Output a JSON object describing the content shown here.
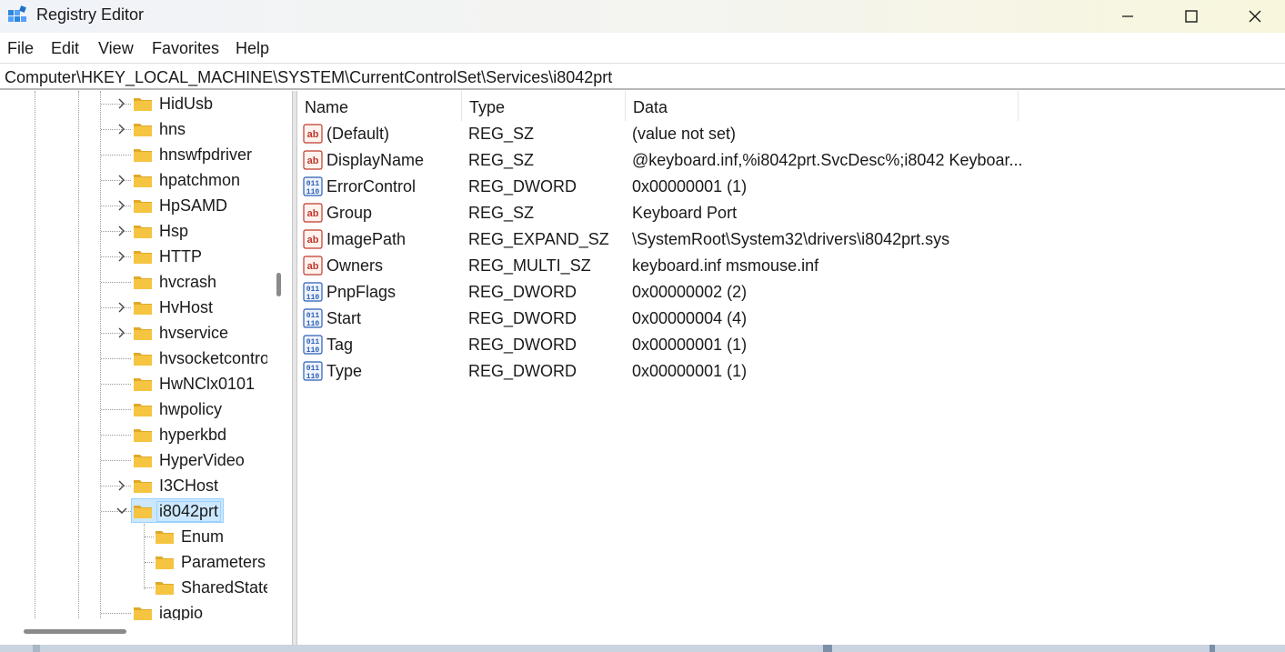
{
  "window": {
    "title": "Registry Editor",
    "icon": "registry-editor-icon"
  },
  "menu": {
    "items": [
      "File",
      "Edit",
      "View",
      "Favorites",
      "Help"
    ]
  },
  "address": {
    "path": "Computer\\HKEY_LOCAL_MACHINE\\SYSTEM\\CurrentControlSet\\Services\\i8042prt"
  },
  "tree": {
    "items": [
      {
        "label": "HidUsb",
        "expandable": true,
        "expanded": false,
        "level": 0
      },
      {
        "label": "hns",
        "expandable": true,
        "expanded": false,
        "level": 0
      },
      {
        "label": "hnswfpdriver",
        "expandable": false,
        "expanded": false,
        "level": 0
      },
      {
        "label": "hpatchmon",
        "expandable": true,
        "expanded": false,
        "level": 0
      },
      {
        "label": "HpSAMD",
        "expandable": true,
        "expanded": false,
        "level": 0
      },
      {
        "label": "Hsp",
        "expandable": true,
        "expanded": false,
        "level": 0
      },
      {
        "label": "HTTP",
        "expandable": true,
        "expanded": false,
        "level": 0
      },
      {
        "label": "hvcrash",
        "expandable": false,
        "expanded": false,
        "level": 0
      },
      {
        "label": "HvHost",
        "expandable": true,
        "expanded": false,
        "level": 0
      },
      {
        "label": "hvservice",
        "expandable": true,
        "expanded": false,
        "level": 0
      },
      {
        "label": "hvsocketcontrol",
        "expandable": false,
        "expanded": false,
        "level": 0
      },
      {
        "label": "HwNClx0101",
        "expandable": false,
        "expanded": false,
        "level": 0
      },
      {
        "label": "hwpolicy",
        "expandable": false,
        "expanded": false,
        "level": 0
      },
      {
        "label": "hyperkbd",
        "expandable": false,
        "expanded": false,
        "level": 0
      },
      {
        "label": "HyperVideo",
        "expandable": false,
        "expanded": false,
        "level": 0
      },
      {
        "label": "I3CHost",
        "expandable": true,
        "expanded": false,
        "level": 0
      },
      {
        "label": "i8042prt",
        "expandable": true,
        "expanded": true,
        "level": 0,
        "selected": true
      },
      {
        "label": "Enum",
        "expandable": false,
        "expanded": false,
        "level": 1
      },
      {
        "label": "Parameters",
        "expandable": false,
        "expanded": false,
        "level": 1
      },
      {
        "label": "SharedState",
        "expandable": false,
        "expanded": false,
        "level": 1
      },
      {
        "label": "iagpio",
        "expandable": false,
        "expanded": false,
        "level": 0
      }
    ]
  },
  "values": {
    "columns": [
      "Name",
      "Type",
      "Data"
    ],
    "rows": [
      {
        "icon": "string-value-icon",
        "name": "(Default)",
        "type": "REG_SZ",
        "data": "(value not set)"
      },
      {
        "icon": "string-value-icon",
        "name": "DisplayName",
        "type": "REG_SZ",
        "data": "@keyboard.inf,%i8042prt.SvcDesc%;i8042 Keyboar..."
      },
      {
        "icon": "binary-value-icon",
        "name": "ErrorControl",
        "type": "REG_DWORD",
        "data": "0x00000001 (1)"
      },
      {
        "icon": "string-value-icon",
        "name": "Group",
        "type": "REG_SZ",
        "data": "Keyboard Port"
      },
      {
        "icon": "string-value-icon",
        "name": "ImagePath",
        "type": "REG_EXPAND_SZ",
        "data": "\\SystemRoot\\System32\\drivers\\i8042prt.sys"
      },
      {
        "icon": "string-value-icon",
        "name": "Owners",
        "type": "REG_MULTI_SZ",
        "data": "keyboard.inf msmouse.inf"
      },
      {
        "icon": "binary-value-icon",
        "name": "PnpFlags",
        "type": "REG_DWORD",
        "data": "0x00000002 (2)"
      },
      {
        "icon": "binary-value-icon",
        "name": "Start",
        "type": "REG_DWORD",
        "data": "0x00000004 (4)"
      },
      {
        "icon": "binary-value-icon",
        "name": "Tag",
        "type": "REG_DWORD",
        "data": "0x00000001 (1)"
      },
      {
        "icon": "binary-value-icon",
        "name": "Type",
        "type": "REG_DWORD",
        "data": "0x00000001 (1)"
      }
    ]
  },
  "colors": {
    "folder": "#f5c542",
    "folder_dark": "#e0a92a",
    "selection": "#cce8ff",
    "string_icon": "#c0392b",
    "binary_icon": "#2b5fb3"
  }
}
